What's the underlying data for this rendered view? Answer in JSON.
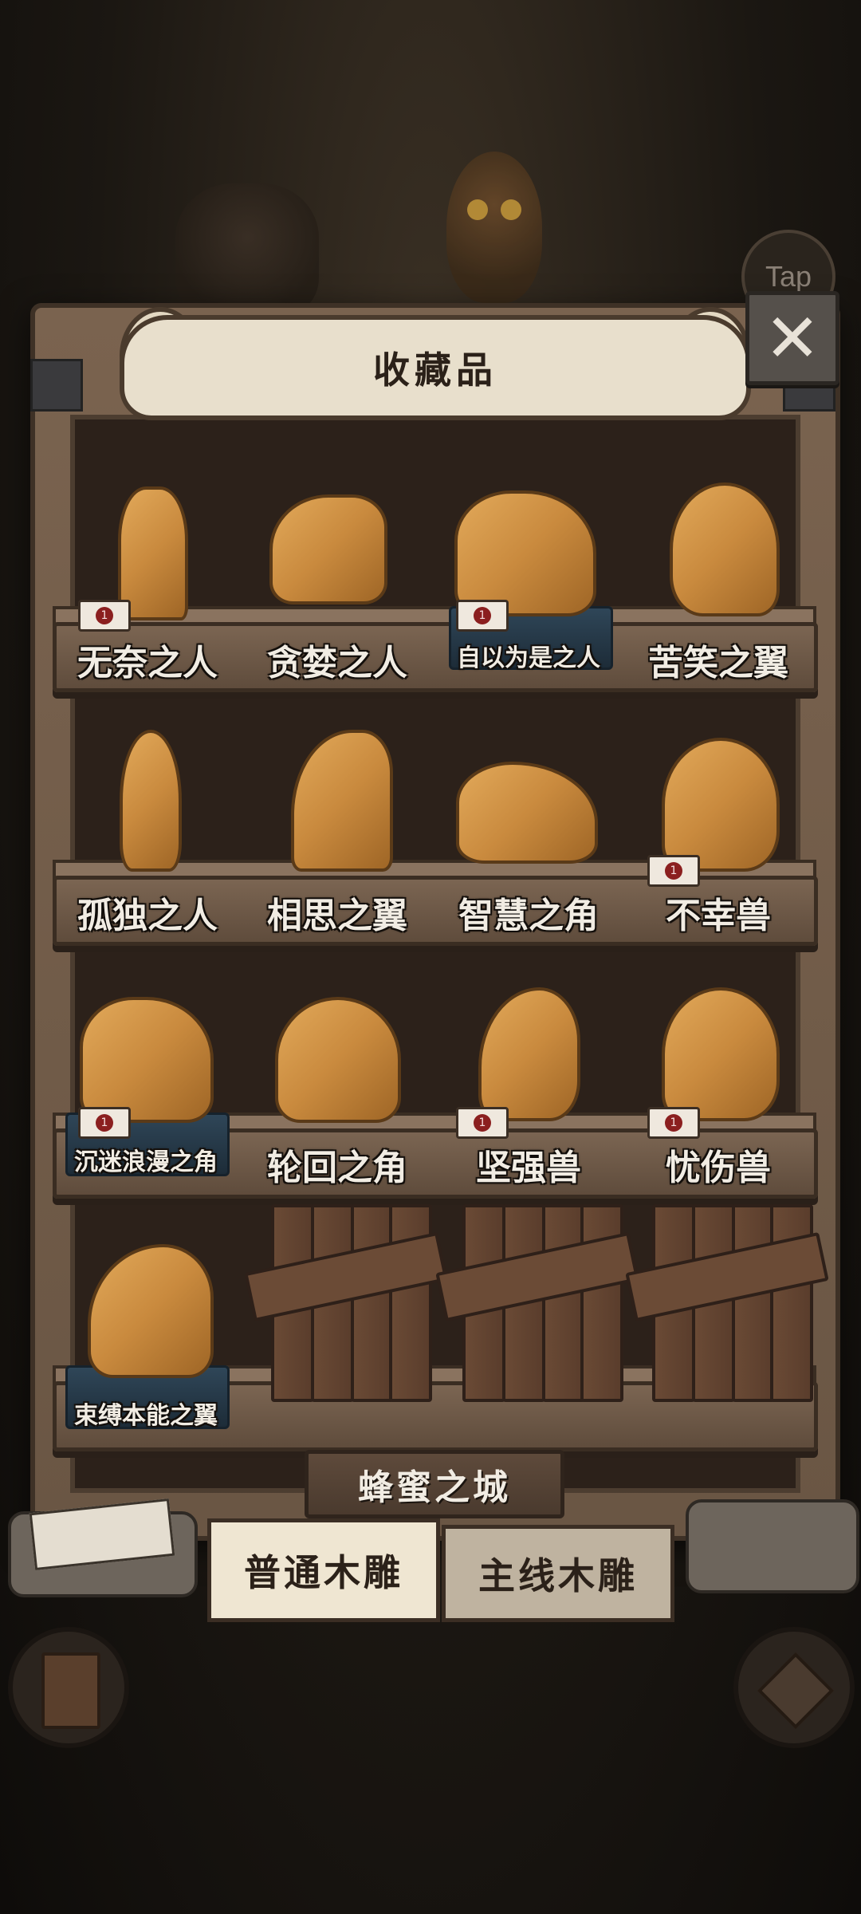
{
  "header": {
    "title": "收藏品",
    "tap_label": "Tap"
  },
  "close": {
    "icon": "close-icon"
  },
  "shelves": [
    [
      {
        "name": "无奈之人",
        "badge": "1",
        "highlight": false
      },
      {
        "name": "贪婪之人",
        "badge": "",
        "highlight": false
      },
      {
        "name": "自以为是之人",
        "badge": "1",
        "highlight": true
      },
      {
        "name": "苦笑之翼",
        "badge": "",
        "highlight": false
      }
    ],
    [
      {
        "name": "孤独之人",
        "badge": "",
        "highlight": false
      },
      {
        "name": "相思之翼",
        "badge": "",
        "highlight": false
      },
      {
        "name": "智慧之角",
        "badge": "",
        "highlight": false
      },
      {
        "name": "不幸兽",
        "badge": "1",
        "highlight": false
      }
    ],
    [
      {
        "name": "沉迷浪漫之角",
        "badge": "1",
        "highlight": true
      },
      {
        "name": "轮回之角",
        "badge": "",
        "highlight": false
      },
      {
        "name": "坚强兽",
        "badge": "1",
        "highlight": false
      },
      {
        "name": "忧伤兽",
        "badge": "1",
        "highlight": false
      }
    ],
    [
      {
        "name": "束缚本能之翼",
        "badge": "",
        "highlight": true
      },
      {
        "name": "",
        "locked": true
      },
      {
        "name": "",
        "locked": true
      },
      {
        "name": "",
        "locked": true
      }
    ]
  ],
  "location_sign": "蜂蜜之城",
  "tabs": [
    {
      "label": "普通木雕",
      "active": true
    },
    {
      "label": "主线木雕",
      "active": false
    }
  ]
}
